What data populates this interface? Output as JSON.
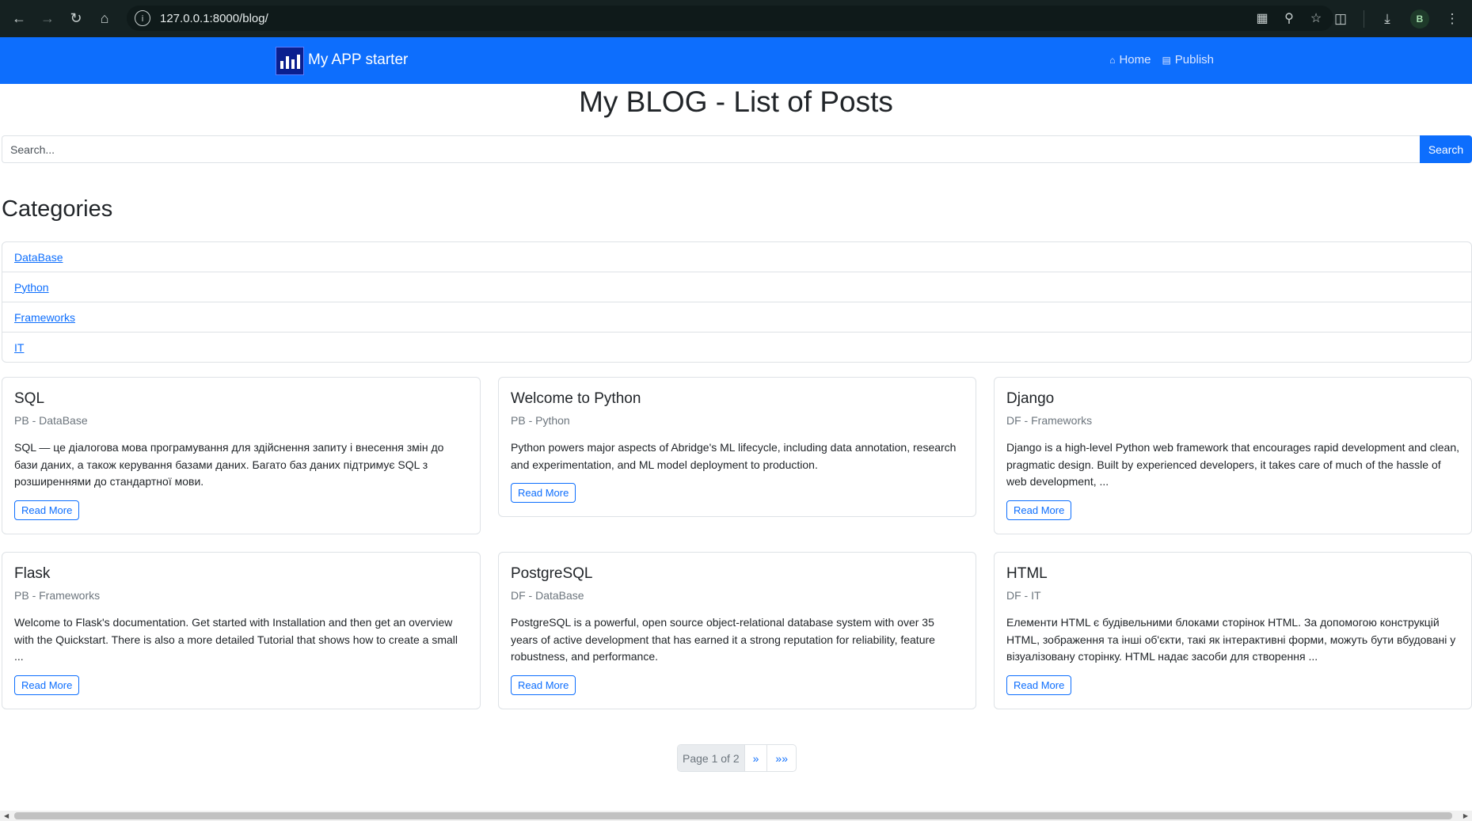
{
  "browser": {
    "url": "127.0.0.1:8000/blog/",
    "profile_initial": "B"
  },
  "navbar": {
    "brand": "My APP starter",
    "links": [
      {
        "label": "Home",
        "icon": "home-icon"
      },
      {
        "label": "Publish",
        "icon": "book-icon"
      }
    ]
  },
  "page": {
    "title": "My BLOG - List of Posts"
  },
  "search": {
    "placeholder": "Search...",
    "button_label": "Search"
  },
  "categories": {
    "title": "Categories",
    "items": [
      "DataBase",
      "Python",
      "Frameworks",
      "IT"
    ]
  },
  "posts": [
    {
      "title": "SQL",
      "meta": "PB - DataBase",
      "excerpt": "SQL — це діалогова мова програмування для здійснення запиту і внесення змін до бази даних, а також керування базами даних. Багато баз даних підтримує SQL з розширеннями до стандартної мови.",
      "button": "Read More"
    },
    {
      "title": "Welcome to Python",
      "meta": "PB - Python",
      "excerpt": "Python powers major aspects of Abridge's ML lifecycle, including data annotation, research and experimentation, and ML model deployment to production.",
      "button": "Read More"
    },
    {
      "title": "Django",
      "meta": "DF - Frameworks",
      "excerpt": "Django is a high-level Python web framework that encourages rapid development and clean, pragmatic design. Built by experienced developers, it takes care of much of the hassle of web development, ...",
      "button": "Read More"
    },
    {
      "title": "Flask",
      "meta": "PB - Frameworks",
      "excerpt": "Welcome to Flask's documentation. Get started with Installation and then get an overview with the Quickstart. There is also a more detailed Tutorial that shows how to create a small ...",
      "button": "Read More"
    },
    {
      "title": "PostgreSQL",
      "meta": "DF - DataBase",
      "excerpt": "PostgreSQL is a powerful, open source object-relational database system with over 35 years of active development that has earned it a strong reputation for reliability, feature robustness, and performance.",
      "button": "Read More"
    },
    {
      "title": "HTML",
      "meta": "DF - IT",
      "excerpt": "Елементи HTML є будівельними блоками сторінок HTML. За допомогою конструкцій HTML, зображення та інші об'єкти, такі як інтерактивні форми, можуть бути вбудовані у візуалізовану сторінку. HTML надає засоби для створення ...",
      "button": "Read More"
    }
  ],
  "pagination": {
    "current": "Page 1 of 2",
    "next": "»",
    "last": "»»"
  }
}
